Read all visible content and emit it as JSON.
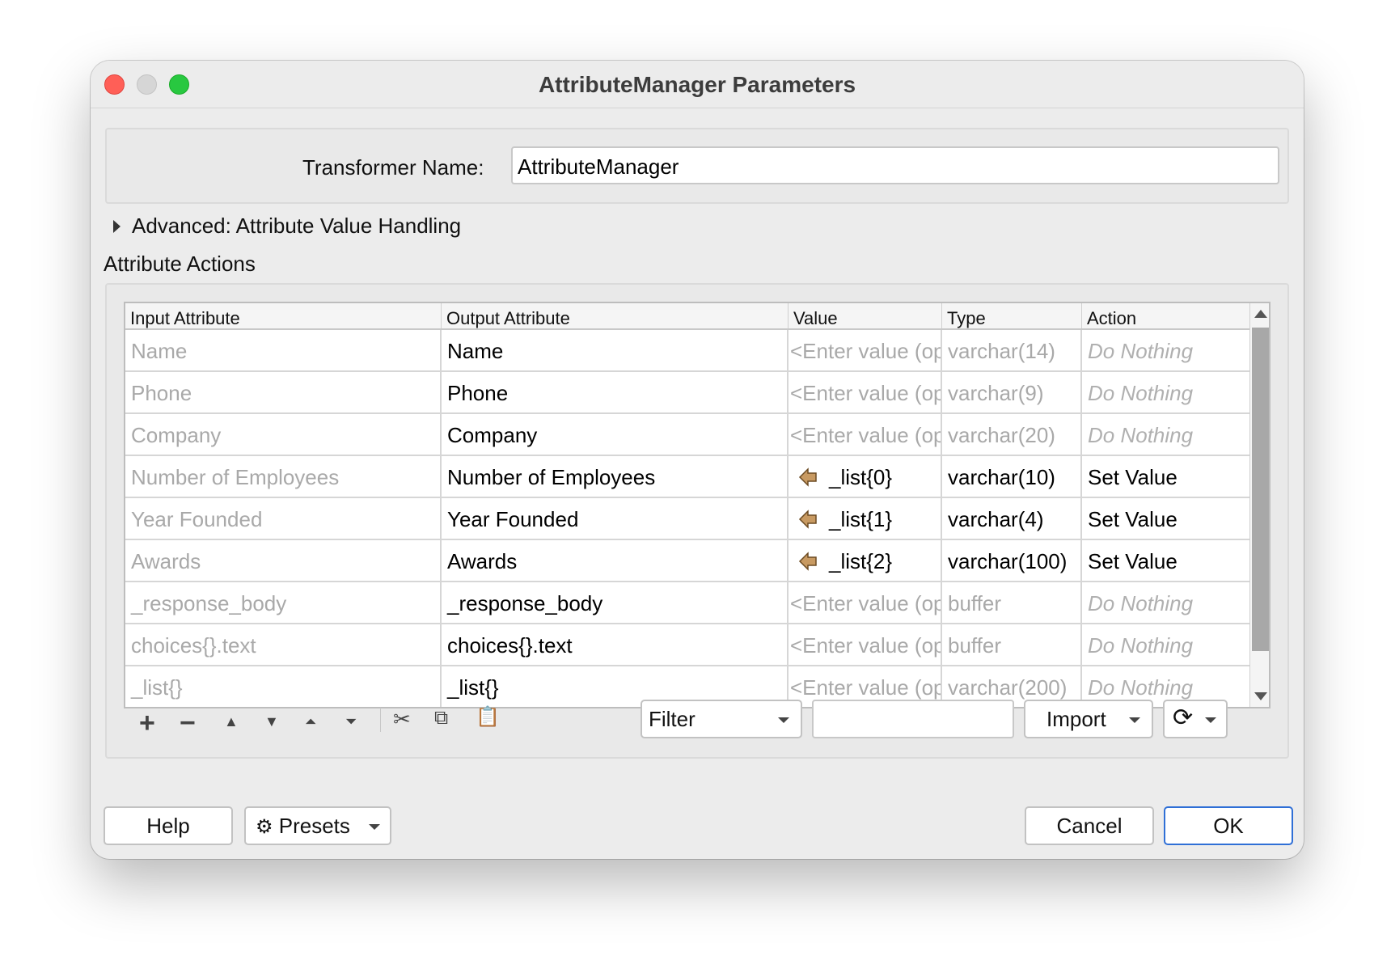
{
  "window": {
    "title": "AttributeManager Parameters"
  },
  "transformer": {
    "label": "Transformer Name:",
    "value": "AttributeManager"
  },
  "advanced": {
    "label": "Advanced: Attribute Value Handling"
  },
  "section": {
    "title": "Attribute Actions"
  },
  "table": {
    "headers": [
      "Input Attribute",
      "Output Attribute",
      "Value",
      "Type",
      "Action"
    ],
    "rows": [
      {
        "input": "Name",
        "output": "Name",
        "value": "<Enter value (optional)>",
        "type": "varchar(14)",
        "action": "Do Nothing"
      },
      {
        "input": "Phone",
        "output": "Phone",
        "value": "<Enter value (optional)>",
        "type": "varchar(9)",
        "action": "Do Nothing"
      },
      {
        "input": "Company",
        "output": "Company",
        "value": "<Enter value (optional)>",
        "type": "varchar(20)",
        "action": "Do Nothing"
      },
      {
        "input": "Number of Employees",
        "output": "Number of Employees",
        "value": "_list{0}",
        "type": "varchar(10)",
        "action": "Set Value"
      },
      {
        "input": "Year Founded",
        "output": "Year Founded",
        "value": "_list{1}",
        "type": "varchar(4)",
        "action": "Set Value"
      },
      {
        "input": "Awards",
        "output": "Awards",
        "value": "_list{2}",
        "type": "varchar(100)",
        "action": "Set Value"
      },
      {
        "input": "_response_body",
        "output": "_response_body",
        "value": "<Enter value (optional)>",
        "type": "buffer",
        "action": "Do Nothing"
      },
      {
        "input": "choices{}.text",
        "output": "choices{}.text",
        "value": "<Enter value (optional)>",
        "type": "buffer",
        "action": "Do Nothing"
      },
      {
        "input": "_list{}",
        "output": "_list{}",
        "value": "<Enter value (optional)>",
        "type": "varchar(200)",
        "action": "Do Nothing"
      }
    ]
  },
  "toolbar": {
    "filter_label": "Filter",
    "filter_text": "",
    "import_label": "Import",
    "icons": [
      "add-icon",
      "remove-icon",
      "move-up-icon",
      "move-down-icon",
      "move-top-icon",
      "move-bottom-icon",
      "cut-icon",
      "copy-icon",
      "paste-icon",
      "refresh-icon"
    ]
  },
  "footer": {
    "help": "Help",
    "presets": "Presets",
    "cancel": "Cancel",
    "ok": "OK"
  },
  "colors": {
    "accent": "#2f6fd6",
    "pointer_icon": "#c89a62"
  }
}
